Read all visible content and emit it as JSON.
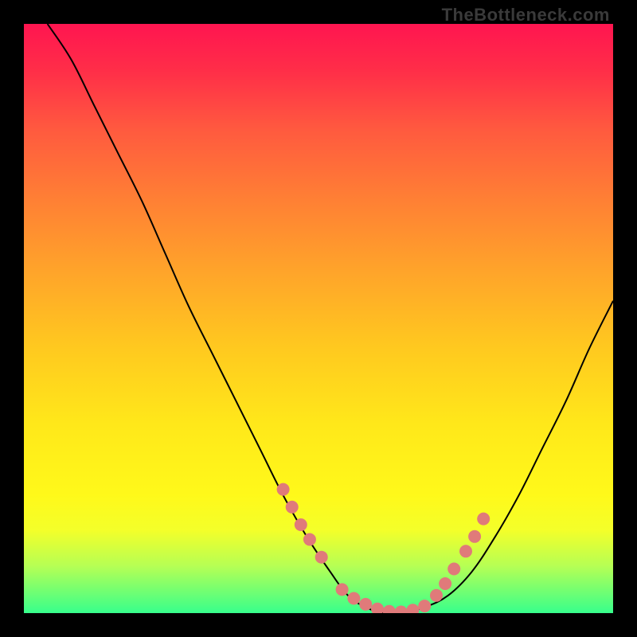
{
  "attribution": "TheBottleneck.com",
  "colors": {
    "dot": "#e07a7a",
    "curve": "#000000",
    "frame_bg_stops": [
      "#ff1550",
      "#ff2e48",
      "#ff5a3f",
      "#ff8034",
      "#ffa42a",
      "#ffc91f",
      "#ffe81a",
      "#fff91a",
      "#f3ff2a",
      "#b6ff54",
      "#37ff8c"
    ],
    "page_bg": "#000000"
  },
  "chart_data": {
    "type": "line",
    "title": "",
    "xlabel": "",
    "ylabel": "",
    "xlim": [
      0,
      100
    ],
    "ylim": [
      0,
      100
    ],
    "grid": false,
    "legend": false,
    "series": [
      {
        "name": "bottleneck-curve",
        "x": [
          4,
          8,
          12,
          16,
          20,
          24,
          28,
          32,
          36,
          40,
          44,
          48,
          52,
          55,
          58,
          61,
          64,
          68,
          72,
          76,
          80,
          84,
          88,
          92,
          96,
          100
        ],
        "y": [
          100,
          94,
          86,
          78,
          70,
          61,
          52,
          44,
          36,
          28,
          20,
          13,
          7,
          3,
          1,
          0,
          0,
          1,
          3,
          7,
          13,
          20,
          28,
          36,
          45,
          53
        ]
      }
    ],
    "highlight_points": {
      "name": "near-optimum-dots",
      "x": [
        44,
        45.5,
        47,
        48.5,
        50.5,
        54,
        56,
        58,
        60,
        62,
        64,
        66,
        68,
        70,
        71.5,
        73,
        75,
        76.5,
        78
      ],
      "y": [
        21,
        18,
        15,
        12.5,
        9.5,
        4,
        2.5,
        1.5,
        0.7,
        0.3,
        0.2,
        0.5,
        1.2,
        3,
        5,
        7.5,
        10.5,
        13,
        16
      ]
    }
  }
}
